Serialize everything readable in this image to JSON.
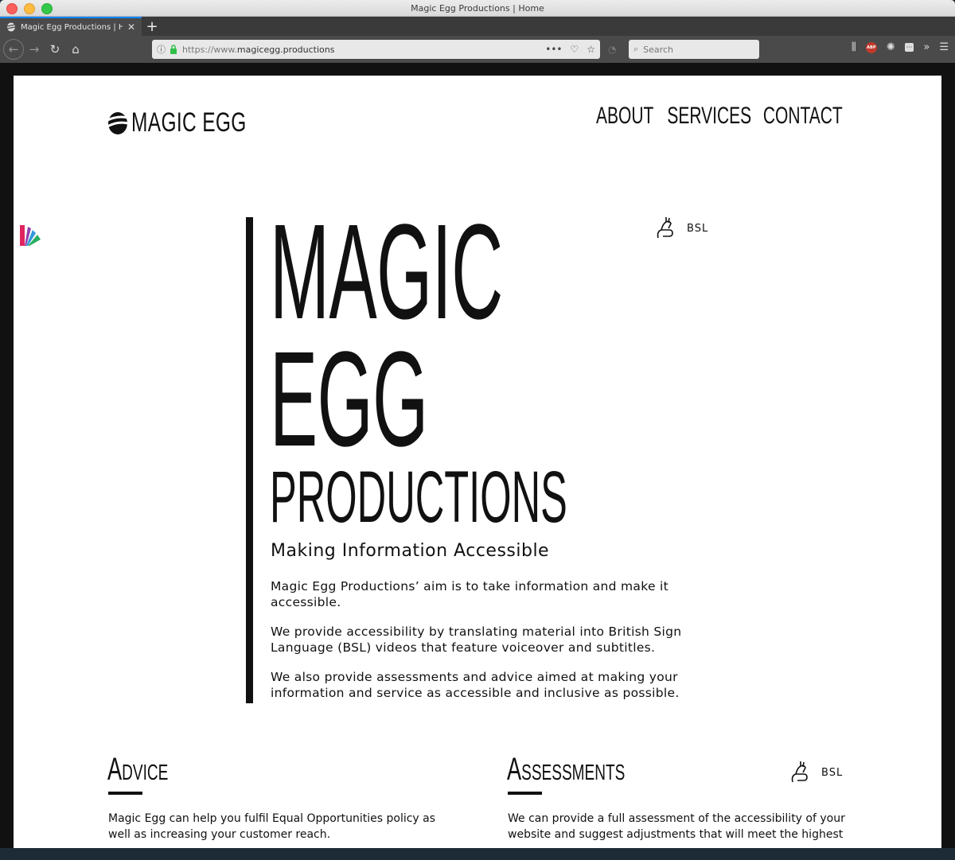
{
  "window": {
    "title": "Magic Egg Productions | Home"
  },
  "tabs": [
    {
      "label": "Magic Egg Productions | Home"
    }
  ],
  "navbar": {
    "url_scheme": "https://www.",
    "url_host": "magicegg.productions",
    "search_placeholder": "Search"
  },
  "site": {
    "logo_text": "MAGIC EGG",
    "nav": [
      "ABOUT",
      "SERVICES",
      "CONTACT"
    ],
    "hero": {
      "line1": "MAGIC",
      "line2": "EGG",
      "line3": "PRODUCTIONS",
      "bsl_label": "BSL",
      "tagline": "Making Information Accessible",
      "paragraphs": [
        "Magic Egg Productions’ aim is to take information and make it accessible.",
        "We provide accessibility by translating material into British Sign Language (BSL) videos that feature voiceover and subtitles.",
        "We also provide assessments and advice aimed at making your information and service as accessible and inclusive as possible."
      ]
    },
    "sections": [
      {
        "title": "Advice",
        "text": "Magic Egg can help you fulfil Equal Opportunities policy as well as increasing your customer reach."
      },
      {
        "title": "Assessments",
        "bsl_label": "BSL",
        "text": "We can provide a full assessment of the accessibility of your website and suggest adjustments that will meet the highest"
      }
    ]
  },
  "colors": {
    "accent_tab": "#0a84ff",
    "text": "#111111",
    "lock": "#2fbf4a"
  },
  "icons": {
    "menu": "hamburger-icon",
    "bsl": "signing-hand-icon"
  }
}
